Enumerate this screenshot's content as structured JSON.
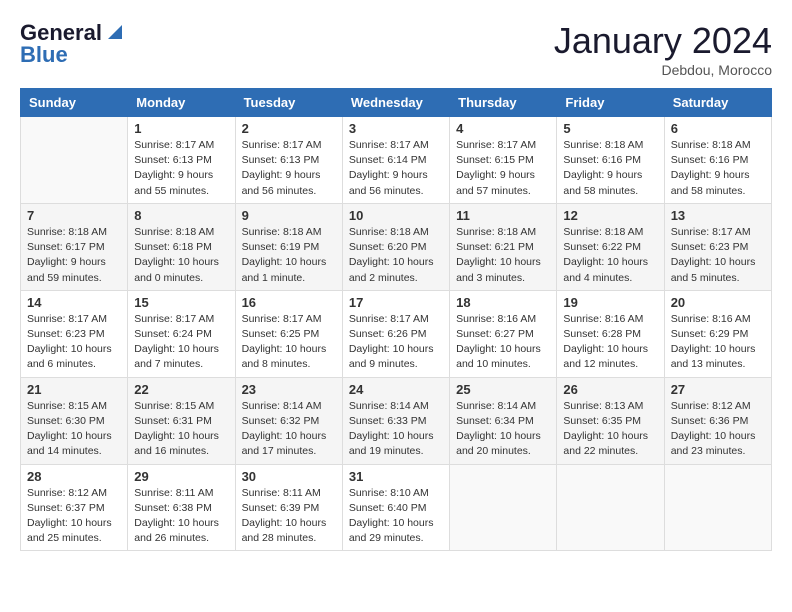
{
  "header": {
    "logo_line1": "General",
    "logo_line2": "Blue",
    "month_year": "January 2024",
    "location": "Debdou, Morocco"
  },
  "days_of_week": [
    "Sunday",
    "Monday",
    "Tuesday",
    "Wednesday",
    "Thursday",
    "Friday",
    "Saturday"
  ],
  "weeks": [
    [
      {
        "day": "",
        "sunrise": "",
        "sunset": "",
        "daylight": ""
      },
      {
        "day": "1",
        "sunrise": "Sunrise: 8:17 AM",
        "sunset": "Sunset: 6:13 PM",
        "daylight": "Daylight: 9 hours and 55 minutes."
      },
      {
        "day": "2",
        "sunrise": "Sunrise: 8:17 AM",
        "sunset": "Sunset: 6:13 PM",
        "daylight": "Daylight: 9 hours and 56 minutes."
      },
      {
        "day": "3",
        "sunrise": "Sunrise: 8:17 AM",
        "sunset": "Sunset: 6:14 PM",
        "daylight": "Daylight: 9 hours and 56 minutes."
      },
      {
        "day": "4",
        "sunrise": "Sunrise: 8:17 AM",
        "sunset": "Sunset: 6:15 PM",
        "daylight": "Daylight: 9 hours and 57 minutes."
      },
      {
        "day": "5",
        "sunrise": "Sunrise: 8:18 AM",
        "sunset": "Sunset: 6:16 PM",
        "daylight": "Daylight: 9 hours and 58 minutes."
      },
      {
        "day": "6",
        "sunrise": "Sunrise: 8:18 AM",
        "sunset": "Sunset: 6:16 PM",
        "daylight": "Daylight: 9 hours and 58 minutes."
      }
    ],
    [
      {
        "day": "7",
        "sunrise": "Sunrise: 8:18 AM",
        "sunset": "Sunset: 6:17 PM",
        "daylight": "Daylight: 9 hours and 59 minutes."
      },
      {
        "day": "8",
        "sunrise": "Sunrise: 8:18 AM",
        "sunset": "Sunset: 6:18 PM",
        "daylight": "Daylight: 10 hours and 0 minutes."
      },
      {
        "day": "9",
        "sunrise": "Sunrise: 8:18 AM",
        "sunset": "Sunset: 6:19 PM",
        "daylight": "Daylight: 10 hours and 1 minute."
      },
      {
        "day": "10",
        "sunrise": "Sunrise: 8:18 AM",
        "sunset": "Sunset: 6:20 PM",
        "daylight": "Daylight: 10 hours and 2 minutes."
      },
      {
        "day": "11",
        "sunrise": "Sunrise: 8:18 AM",
        "sunset": "Sunset: 6:21 PM",
        "daylight": "Daylight: 10 hours and 3 minutes."
      },
      {
        "day": "12",
        "sunrise": "Sunrise: 8:18 AM",
        "sunset": "Sunset: 6:22 PM",
        "daylight": "Daylight: 10 hours and 4 minutes."
      },
      {
        "day": "13",
        "sunrise": "Sunrise: 8:17 AM",
        "sunset": "Sunset: 6:23 PM",
        "daylight": "Daylight: 10 hours and 5 minutes."
      }
    ],
    [
      {
        "day": "14",
        "sunrise": "Sunrise: 8:17 AM",
        "sunset": "Sunset: 6:23 PM",
        "daylight": "Daylight: 10 hours and 6 minutes."
      },
      {
        "day": "15",
        "sunrise": "Sunrise: 8:17 AM",
        "sunset": "Sunset: 6:24 PM",
        "daylight": "Daylight: 10 hours and 7 minutes."
      },
      {
        "day": "16",
        "sunrise": "Sunrise: 8:17 AM",
        "sunset": "Sunset: 6:25 PM",
        "daylight": "Daylight: 10 hours and 8 minutes."
      },
      {
        "day": "17",
        "sunrise": "Sunrise: 8:17 AM",
        "sunset": "Sunset: 6:26 PM",
        "daylight": "Daylight: 10 hours and 9 minutes."
      },
      {
        "day": "18",
        "sunrise": "Sunrise: 8:16 AM",
        "sunset": "Sunset: 6:27 PM",
        "daylight": "Daylight: 10 hours and 10 minutes."
      },
      {
        "day": "19",
        "sunrise": "Sunrise: 8:16 AM",
        "sunset": "Sunset: 6:28 PM",
        "daylight": "Daylight: 10 hours and 12 minutes."
      },
      {
        "day": "20",
        "sunrise": "Sunrise: 8:16 AM",
        "sunset": "Sunset: 6:29 PM",
        "daylight": "Daylight: 10 hours and 13 minutes."
      }
    ],
    [
      {
        "day": "21",
        "sunrise": "Sunrise: 8:15 AM",
        "sunset": "Sunset: 6:30 PM",
        "daylight": "Daylight: 10 hours and 14 minutes."
      },
      {
        "day": "22",
        "sunrise": "Sunrise: 8:15 AM",
        "sunset": "Sunset: 6:31 PM",
        "daylight": "Daylight: 10 hours and 16 minutes."
      },
      {
        "day": "23",
        "sunrise": "Sunrise: 8:14 AM",
        "sunset": "Sunset: 6:32 PM",
        "daylight": "Daylight: 10 hours and 17 minutes."
      },
      {
        "day": "24",
        "sunrise": "Sunrise: 8:14 AM",
        "sunset": "Sunset: 6:33 PM",
        "daylight": "Daylight: 10 hours and 19 minutes."
      },
      {
        "day": "25",
        "sunrise": "Sunrise: 8:14 AM",
        "sunset": "Sunset: 6:34 PM",
        "daylight": "Daylight: 10 hours and 20 minutes."
      },
      {
        "day": "26",
        "sunrise": "Sunrise: 8:13 AM",
        "sunset": "Sunset: 6:35 PM",
        "daylight": "Daylight: 10 hours and 22 minutes."
      },
      {
        "day": "27",
        "sunrise": "Sunrise: 8:12 AM",
        "sunset": "Sunset: 6:36 PM",
        "daylight": "Daylight: 10 hours and 23 minutes."
      }
    ],
    [
      {
        "day": "28",
        "sunrise": "Sunrise: 8:12 AM",
        "sunset": "Sunset: 6:37 PM",
        "daylight": "Daylight: 10 hours and 25 minutes."
      },
      {
        "day": "29",
        "sunrise": "Sunrise: 8:11 AM",
        "sunset": "Sunset: 6:38 PM",
        "daylight": "Daylight: 10 hours and 26 minutes."
      },
      {
        "day": "30",
        "sunrise": "Sunrise: 8:11 AM",
        "sunset": "Sunset: 6:39 PM",
        "daylight": "Daylight: 10 hours and 28 minutes."
      },
      {
        "day": "31",
        "sunrise": "Sunrise: 8:10 AM",
        "sunset": "Sunset: 6:40 PM",
        "daylight": "Daylight: 10 hours and 29 minutes."
      },
      {
        "day": "",
        "sunrise": "",
        "sunset": "",
        "daylight": ""
      },
      {
        "day": "",
        "sunrise": "",
        "sunset": "",
        "daylight": ""
      },
      {
        "day": "",
        "sunrise": "",
        "sunset": "",
        "daylight": ""
      }
    ]
  ]
}
